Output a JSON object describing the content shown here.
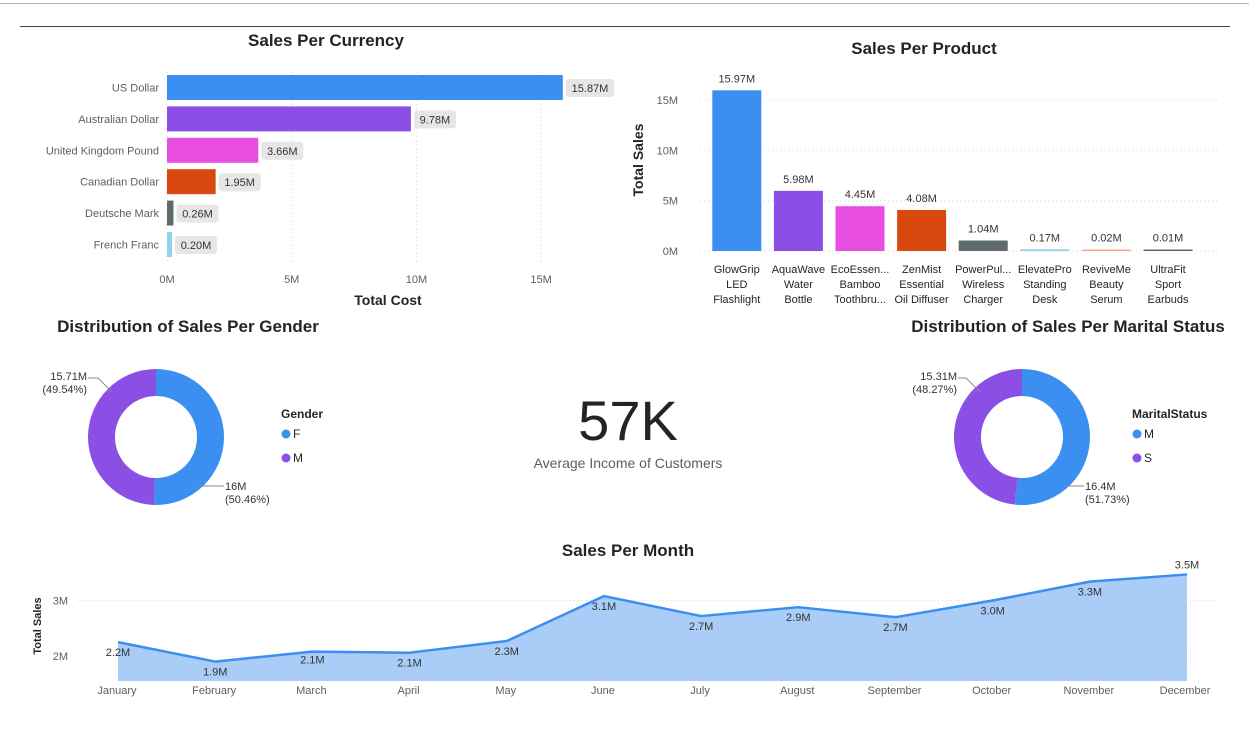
{
  "palette": {
    "blue": "#3a8ff0",
    "purple": "#8c4fe6",
    "pink": "#e84fe0",
    "orange": "#d9480f",
    "slate": "#5f6b6d",
    "lightblue": "#8fd3ec",
    "peach": "#f4a78a",
    "area": "#a9cdf7"
  },
  "chart_data": [
    {
      "id": "currency",
      "type": "bar",
      "orientation": "horizontal",
      "title": "Sales Per Currency",
      "xlabel": "Total Cost",
      "categories": [
        "US Dollar",
        "Australian Dollar",
        "United Kingdom Pound",
        "Canadian Dollar",
        "Deutsche Mark",
        "French Franc"
      ],
      "values": [
        15.87,
        9.78,
        3.66,
        1.95,
        0.26,
        0.2
      ],
      "labels": [
        "15.87M",
        "9.78M",
        "3.66M",
        "1.95M",
        "0.26M",
        "0.20M"
      ],
      "colors": [
        "#3a8ff0",
        "#8c4fe6",
        "#e84fe0",
        "#d9480f",
        "#5f6b6d",
        "#8fd3ec"
      ],
      "xlim": [
        0,
        17
      ],
      "xticks": [
        0,
        5,
        10,
        15
      ],
      "xtick_labels": [
        "0M",
        "5M",
        "10M",
        "15M"
      ]
    },
    {
      "id": "product",
      "type": "bar",
      "title": "Sales Per Product",
      "ylabel": "Total Sales",
      "categories": [
        [
          "GlowGrip",
          "LED",
          "Flashlight"
        ],
        [
          "AquaWave",
          "Water",
          "Bottle"
        ],
        [
          "EcoEssen...",
          "Bamboo",
          "Toothbru..."
        ],
        [
          "ZenMist",
          "Essential",
          "Oil Diffuser"
        ],
        [
          "PowerPul...",
          "Wireless",
          "Charger"
        ],
        [
          "ElevatePro",
          "Standing",
          "Desk"
        ],
        [
          "ReviveMe",
          "Beauty",
          "Serum"
        ],
        [
          "UltraFit",
          "Sport",
          "Earbuds"
        ]
      ],
      "values": [
        15.97,
        5.98,
        4.45,
        4.08,
        1.04,
        0.17,
        0.02,
        0.01
      ],
      "labels": [
        "15.97M",
        "5.98M",
        "4.45M",
        "4.08M",
        "1.04M",
        "0.17M",
        "0.02M",
        "0.01M"
      ],
      "colors": [
        "#3a8ff0",
        "#8c4fe6",
        "#e84fe0",
        "#d9480f",
        "#5f6b6d",
        "#8fd3ec",
        "#f4a78a",
        "#5f6b6d"
      ],
      "ylim": [
        0,
        16
      ],
      "yticks": [
        0,
        5,
        10,
        15
      ],
      "ytick_labels": [
        "0M",
        "5M",
        "10M",
        "15M"
      ]
    },
    {
      "id": "gender",
      "type": "pie",
      "donut": true,
      "title": "Distribution of Sales Per Gender",
      "legend_title": "Gender",
      "categories": [
        "F",
        "M"
      ],
      "values": [
        16.0,
        15.71
      ],
      "percents": [
        "(50.46%)",
        "(49.54%)"
      ],
      "value_labels": [
        "16M",
        "15.71M"
      ],
      "colors": [
        "#3a8ff0",
        "#8c4fe6"
      ]
    },
    {
      "id": "marital",
      "type": "pie",
      "donut": true,
      "title": "Distribution of Sales Per Marital Status",
      "legend_title": "MaritalStatus",
      "categories": [
        "M",
        "S"
      ],
      "values": [
        16.4,
        15.31
      ],
      "percents": [
        "(51.73%)",
        "(48.27%)"
      ],
      "value_labels": [
        "16.4M",
        "15.31M"
      ],
      "colors": [
        "#3a8ff0",
        "#8c4fe6"
      ]
    },
    {
      "id": "month",
      "type": "area",
      "title": "Sales Per Month",
      "ylabel": "Total Sales",
      "categories": [
        "January",
        "February",
        "March",
        "April",
        "May",
        "June",
        "July",
        "August",
        "September",
        "October",
        "November",
        "December"
      ],
      "values": [
        2.25,
        1.9,
        2.08,
        2.06,
        2.27,
        3.08,
        2.72,
        2.88,
        2.7,
        3.0,
        3.34,
        3.47
      ],
      "labels": [
        "2.2M",
        "1.9M",
        "2.1M",
        "2.1M",
        "2.3M",
        "3.1M",
        "2.7M",
        "2.9M",
        "2.7M",
        "3.0M",
        "3.3M",
        "3.5M"
      ],
      "ylim": [
        1.55,
        3.55
      ],
      "yticks": [
        2,
        3
      ],
      "ytick_labels": [
        "2M",
        "3M"
      ]
    }
  ],
  "kpi": {
    "value": "57K",
    "label": "Average Income of Customers"
  }
}
